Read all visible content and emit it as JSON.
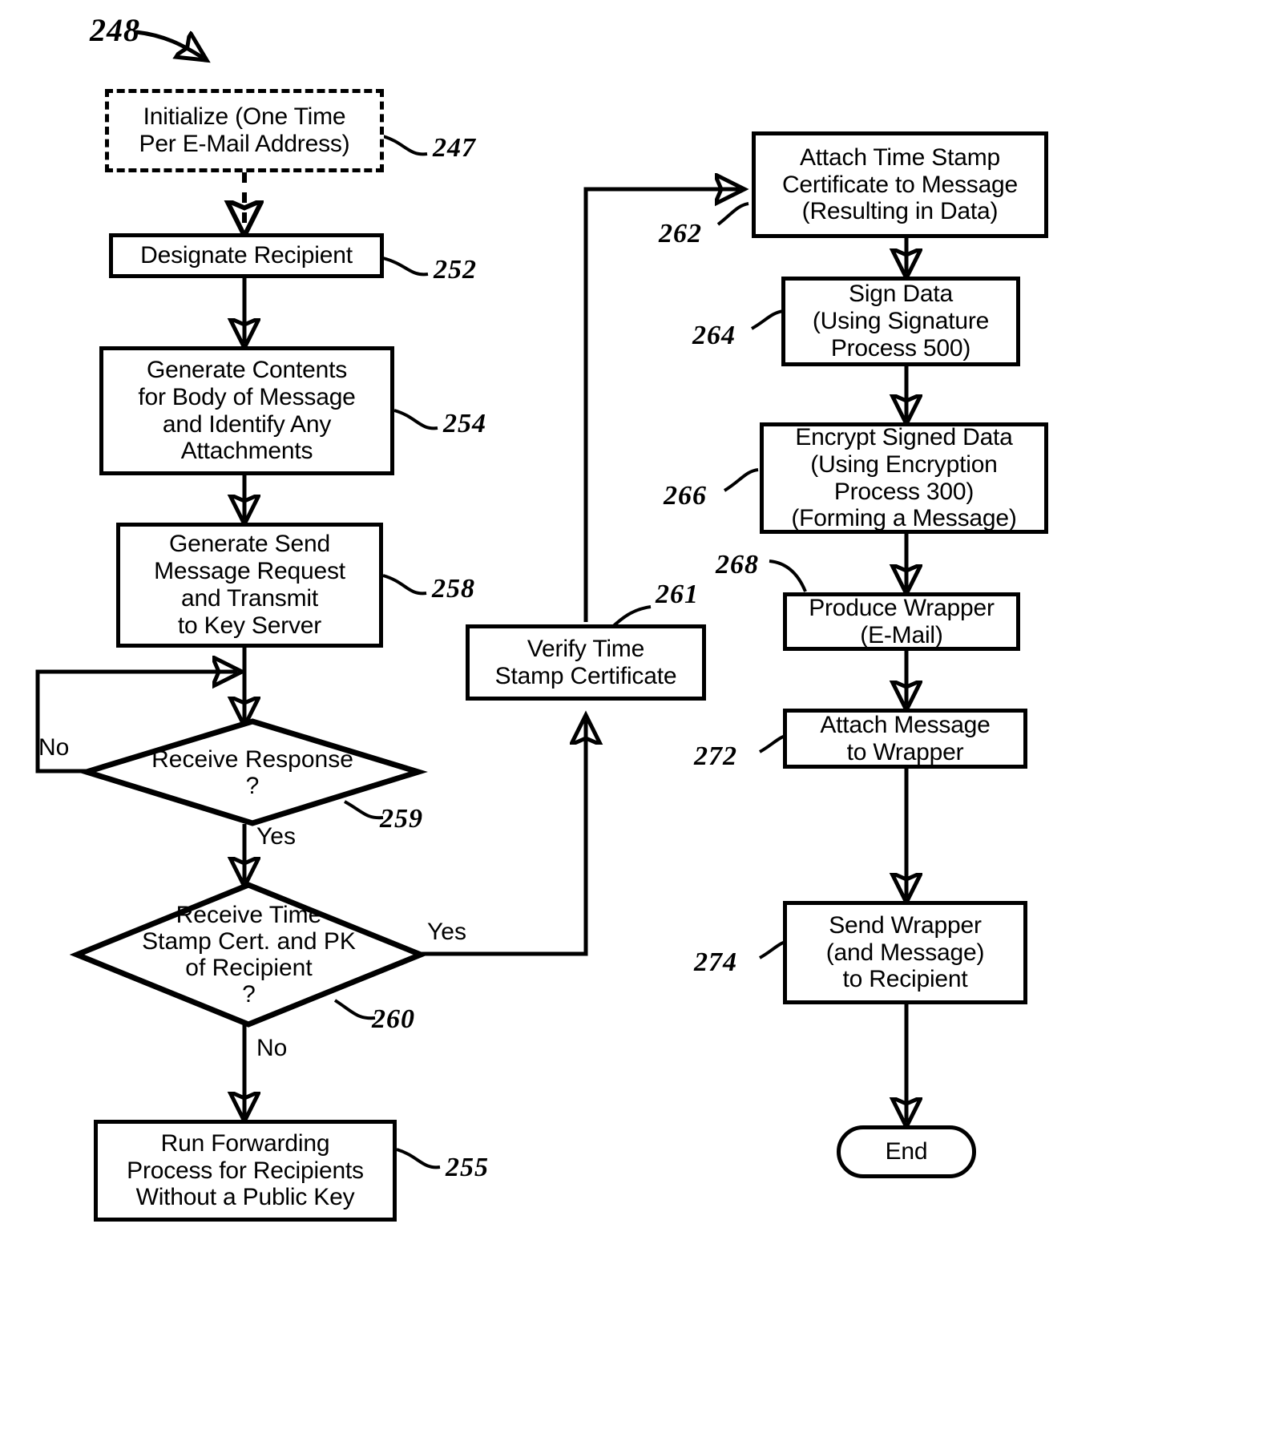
{
  "figure": {
    "number": "248"
  },
  "nodes": {
    "initialize": {
      "text": "Initialize (One Time\nPer E-Mail Address)",
      "ref": "247"
    },
    "designate": {
      "text": "Designate Recipient",
      "ref": "252"
    },
    "generate_contents": {
      "text": "Generate Contents\nfor Body of Message\nand Identify Any\nAttachments",
      "ref": "254"
    },
    "generate_send": {
      "text": "Generate Send\nMessage Request\nand Transmit\nto Key Server",
      "ref": "258"
    },
    "receive_response": {
      "text": "Receive Response\n?",
      "ref": "259"
    },
    "receive_ts": {
      "text": "Receive Time\nStamp Cert. and PK\nof Recipient\n?",
      "ref": "260"
    },
    "forwarding": {
      "text": "Run Forwarding\nProcess for Recipients\nWithout a Public Key",
      "ref": "255"
    },
    "verify_ts": {
      "text": "Verify Time\nStamp Certificate",
      "ref": "261"
    },
    "attach_ts": {
      "text": "Attach Time Stamp\nCertificate to Message\n(Resulting in Data)",
      "ref": "262"
    },
    "sign_data": {
      "text": "Sign Data\n(Using Signature\nProcess 500)",
      "ref": "264"
    },
    "encrypt": {
      "text": "Encrypt Signed Data\n(Using Encryption\nProcess 300)\n(Forming a Message)",
      "ref": "266"
    },
    "produce_wrapper": {
      "text": "Produce Wrapper\n(E-Mail)",
      "ref": "268"
    },
    "attach_msg": {
      "text": "Attach Message\nto Wrapper",
      "ref": "272"
    },
    "send_wrapper": {
      "text": "Send Wrapper\n(and Message)\nto Recipient",
      "ref": "274"
    },
    "end": {
      "text": "End",
      "ref": ""
    }
  },
  "edge_labels": {
    "response_no": "No",
    "response_yes": "Yes",
    "ts_yes": "Yes",
    "ts_no": "No"
  },
  "colors": {
    "ink": "#000000",
    "paper": "#ffffff"
  }
}
